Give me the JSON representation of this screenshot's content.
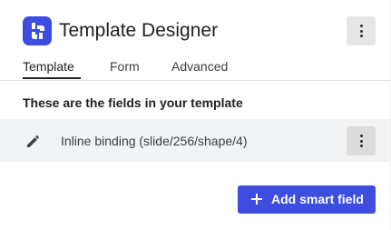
{
  "header": {
    "logo_icon": "template-designer-logo-icon",
    "title": "Template Designer",
    "menu_icon": "more-vertical-icon"
  },
  "tabs": [
    {
      "label": "Template",
      "active": true
    },
    {
      "label": "Form",
      "active": false
    },
    {
      "label": "Advanced",
      "active": false
    }
  ],
  "main": {
    "section_label": "These are the fields in your template",
    "fields": [
      {
        "icon": "pencil-icon",
        "label": "Inline binding (slide/256/shape/4)",
        "menu_icon": "more-vertical-icon"
      }
    ],
    "add_button": {
      "icon": "plus-icon",
      "label": "Add smart field"
    }
  },
  "colors": {
    "accent": "#3c4de0",
    "row_background": "#f1f3f4",
    "icon_button_background": "#e6e6e6"
  }
}
